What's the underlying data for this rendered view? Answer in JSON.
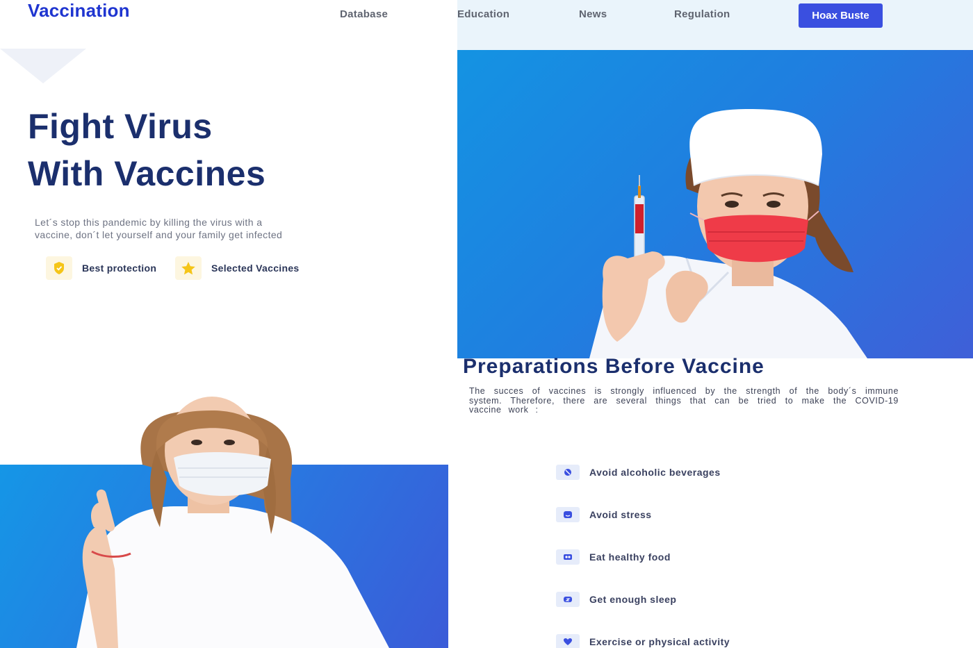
{
  "header": {
    "brand": "Vaccination",
    "nav": [
      "Database",
      "Education",
      "News",
      "Regulation"
    ],
    "cta_label": "Hoax Buste"
  },
  "hero": {
    "headline_line1": "Fight Virus",
    "headline_line2": "With Vaccines",
    "lead": "Let´s stop this pandemic by killing the virus with a vaccine, don´t let yourself and your family get infected",
    "features": [
      {
        "label": "Best protection",
        "icon": "shield-icon"
      },
      {
        "label": "Selected Vaccines",
        "icon": "star-icon"
      }
    ]
  },
  "preparations": {
    "title": "Preparations Before Vaccine",
    "text": "The succes of vaccines is strongly influenced by the strength of the body´s immune system. Therefore, there are several things that can be tried to make the COVID-19 vaccine work :",
    "tips": [
      {
        "label": "Avoid alcoholic beverages",
        "icon": "no-alcohol-icon"
      },
      {
        "label": "Avoid stress",
        "icon": "calm-icon"
      },
      {
        "label": "Eat healthy food",
        "icon": "food-icon"
      },
      {
        "label": "Get enough sleep",
        "icon": "sleep-icon"
      },
      {
        "label": "Exercise or physical activity",
        "icon": "heart-icon"
      }
    ]
  },
  "colors": {
    "brand": "#1f35d0",
    "cta": "#3a4fe0",
    "headline": "#1b2f6d",
    "hero_blue": "#1493e2",
    "accent_yellow": "#f5c518"
  }
}
